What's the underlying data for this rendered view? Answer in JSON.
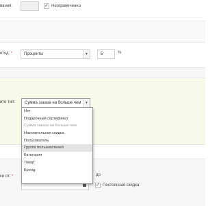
{
  "row1": {
    "label": "вания:",
    "unlimited_label": "Неограниченно",
    "unlimited_checked": true
  },
  "row2": {
    "label": "етод:",
    "method_value": "Проценты",
    "amount_value": "5",
    "unit": "%"
  },
  "row3": {
    "label": "ите тип:",
    "type_value": "Сумма заказа на больше чем",
    "options": [
      {
        "label": "Нет",
        "state": "normal"
      },
      {
        "label": "Подарочный сертификат",
        "state": "normal"
      },
      {
        "label": "Сумма заказа на больше чем",
        "state": "disabled"
      },
      {
        "label": "Накопительная скидка",
        "state": "normal"
      },
      {
        "label": "Пользователь",
        "state": "normal"
      },
      {
        "label": "Группа пользователей",
        "state": "hover"
      },
      {
        "label": "Категория",
        "state": "normal"
      },
      {
        "label": "Товар",
        "state": "normal"
      },
      {
        "label": "Бренд",
        "state": "normal"
      }
    ]
  },
  "row4": {
    "label": "ки от:",
    "to_label": "до",
    "permanent_label": "Постоянная скидка",
    "permanent_checked": true
  },
  "colors": {
    "highlight_band": "#f7fae9",
    "required": "#d9534f"
  }
}
